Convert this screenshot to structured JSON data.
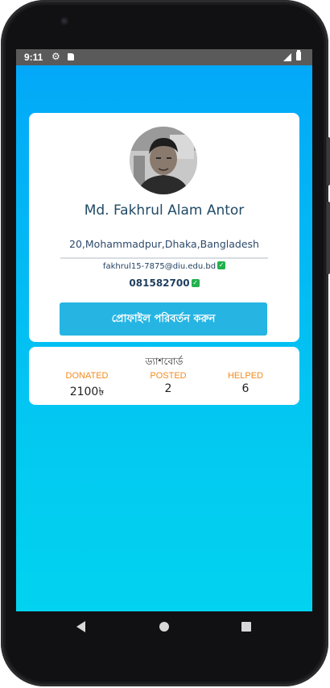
{
  "status_bar": {
    "time": "9:11",
    "icons": [
      "gear-icon",
      "sd-card-icon",
      "signal-icon",
      "battery-icon"
    ]
  },
  "colors": {
    "background_top": "#03a7f8",
    "background_bottom": "#02d3f0",
    "card": "#ffffff",
    "button": "#26b5e3",
    "name_text": "#214a66",
    "stat_label": "#f28b1c",
    "verified": "#22b14c"
  },
  "profile": {
    "avatar_icon": "profile-photo",
    "name": "Md. Fakhrul Alam Antor",
    "address": "20,Mohammadpur,Dhaka,Bangladesh",
    "email": "fakhrul15-7875@diu.edu.bd",
    "phone": "081582700",
    "email_verified": true,
    "phone_verified": true,
    "edit_button_label": "প্রোফাইল পরিবর্তন করুন"
  },
  "dashboard": {
    "title": "ড্যাশবোর্ড",
    "stats": [
      {
        "label": "DONATED",
        "value": "2100৳"
      },
      {
        "label": "POSTED",
        "value": "2"
      },
      {
        "label": "HELPED",
        "value": "6"
      }
    ]
  },
  "nav": {
    "icons": [
      "back-icon",
      "home-icon",
      "recents-icon"
    ]
  }
}
